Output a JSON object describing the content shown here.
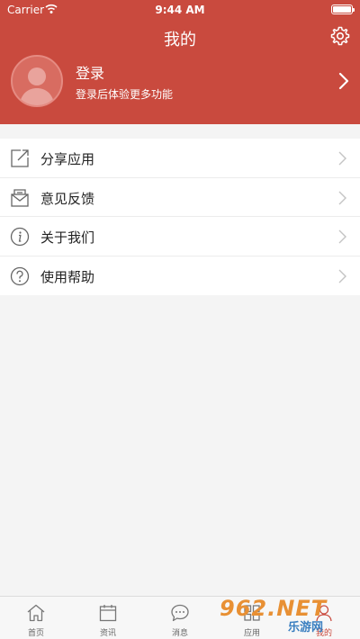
{
  "status_bar": {
    "carrier": "Carrier",
    "time": "9:44 AM"
  },
  "header": {
    "title": "我的"
  },
  "profile": {
    "title": "登录",
    "subtitle": "登录后体验更多功能"
  },
  "menu": [
    {
      "label": "分享应用",
      "icon": "share-icon"
    },
    {
      "label": "意见反馈",
      "icon": "feedback-mail-icon"
    },
    {
      "label": "关于我们",
      "icon": "info-icon"
    },
    {
      "label": "使用帮助",
      "icon": "help-icon"
    }
  ],
  "tabs": [
    {
      "label": "首页",
      "icon": "home-icon"
    },
    {
      "label": "资讯",
      "icon": "calendar-icon"
    },
    {
      "label": "消息",
      "icon": "chat-icon"
    },
    {
      "label": "应用",
      "icon": "apps-icon"
    },
    {
      "label": "我的",
      "icon": "user-icon",
      "active": true
    }
  ],
  "watermark": {
    "logo": "962.NET",
    "text": "乐游网"
  },
  "colors": {
    "brand": "#c94a3e",
    "background": "#f4f4f4"
  }
}
